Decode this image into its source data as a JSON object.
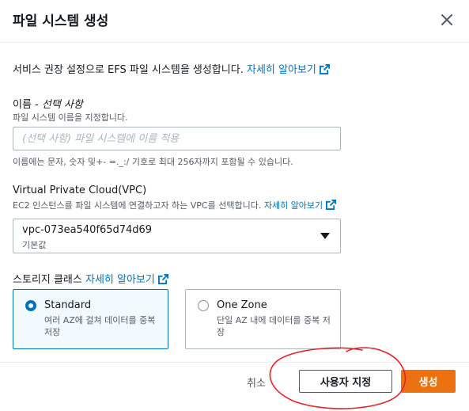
{
  "header": {
    "title": "파일 시스템 생성",
    "close_icon": "close-icon"
  },
  "intro": {
    "text": "서비스 권장 설정으로 EFS 파일 시스템을 생성합니다.",
    "link": "자세히 알아보기"
  },
  "name_field": {
    "label": "이름",
    "label_suffix": "선택 사항",
    "description": "파일 시스템 이름을 지정합니다.",
    "placeholder": "(선택 사항) 파일 시스템에 이름 적용",
    "value": "",
    "constraint": "이름에는 문자, 숫자 및+- =._:/ 기호로 최대 256자까지 포함될 수 있습니다."
  },
  "vpc_field": {
    "label": "Virtual Private Cloud(VPC)",
    "description": "EC2 인스턴스를 파일 시스템에 연결하고자 하는 VPC를 선택합니다.",
    "link": "자세히 알아보기",
    "selected_value": "vpc-073ea540f65d74d69",
    "selected_sub": "기본값"
  },
  "storage_class": {
    "label": "스토리지 클래스",
    "link": "자세히 알아보기",
    "options": [
      {
        "title": "Standard",
        "description": "여러 AZ에 걸쳐 데이터를 중복 저장",
        "selected": true
      },
      {
        "title": "One Zone",
        "description": "단일 AZ 내에 데이터를 중복 저장",
        "selected": false
      }
    ]
  },
  "footer": {
    "cancel_label": "취소",
    "customize_label": "사용자 지정",
    "create_label": "생성"
  },
  "colors": {
    "link": "#0073bb",
    "primary_button": "#ec7211",
    "selected_tile_bg": "#f1faff",
    "annotation": "#e3242b"
  }
}
